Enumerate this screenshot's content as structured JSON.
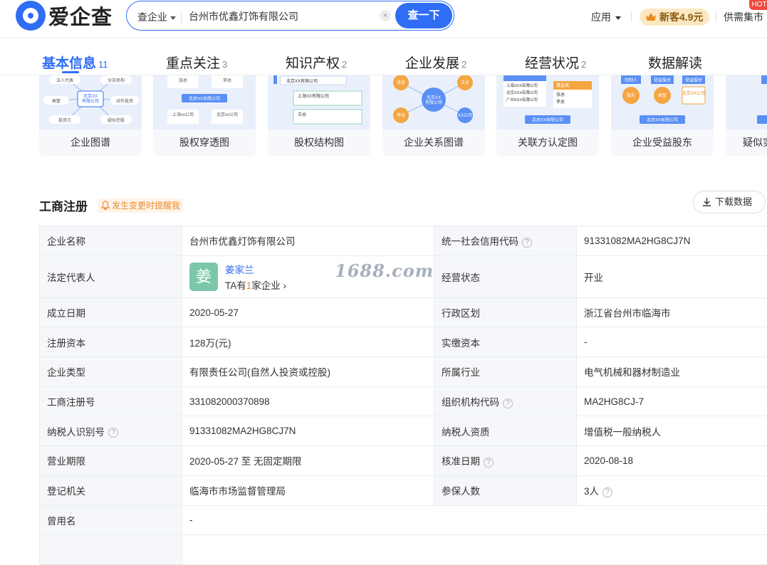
{
  "header": {
    "logo_text": "爱企查",
    "search_type": "查企业",
    "search_value": "台州市优鑫灯饰有限公司",
    "search_button": "查一下",
    "nav_apps": "应用",
    "vip_label": "新客4.9元",
    "supply_label": "供需集市",
    "hot_badge": "HOT"
  },
  "tabs": [
    {
      "label": "基本信息",
      "count": "11"
    },
    {
      "label": "重点关注",
      "count": "3"
    },
    {
      "label": "知识产权",
      "count": "2"
    },
    {
      "label": "企业发展",
      "count": "2"
    },
    {
      "label": "经营状况",
      "count": "2"
    },
    {
      "label": "数据解读",
      "count": ""
    }
  ],
  "cards": [
    {
      "label": "企业图谱",
      "icon": "graph-icon"
    },
    {
      "label": "股权穿透图",
      "icon": "equity-penetration-icon"
    },
    {
      "label": "股权结构图",
      "icon": "equity-structure-icon"
    },
    {
      "label": "企业关系图谱",
      "icon": "relation-graph-icon"
    },
    {
      "label": "关联方认定图",
      "icon": "related-party-icon"
    },
    {
      "label": "企业受益股东",
      "icon": "beneficiary-icon"
    },
    {
      "label": "疑似实",
      "icon": "suspected-controller-icon"
    }
  ],
  "card_thumbs": {
    "c1_center": "北京XX\n有限公司",
    "c1_a": "法人代表",
    "c1_b": "分支机构",
    "c1_c": "高管",
    "c1_d": "对外投资",
    "c1_e": "投资方",
    "c1_f": "疑似控股",
    "c2_a": "张总",
    "c2_b": "李总",
    "c2_center": "北京XX有限公司",
    "c2_c": "上海xx公司",
    "c2_d": "北京xx公司",
    "c3_a": "北京XX有限公司",
    "c3_b": "上海XX有限公司",
    "c3_c": "王总",
    "c4_center": "北京XX\n有限公司",
    "c4_a": "张总",
    "c4_b": "王总",
    "c4_c": "李总",
    "c4_d": "XX公司",
    "c5_a": "上海XXX有限公司",
    "c5_b": "北京XXX有限公司",
    "c5_c": "广州XXX有限公司",
    "c5_d": "董监高",
    "c5_e": "张总",
    "c5_f": "李总",
    "c5_g": "北京XX有限公司",
    "c6_a": "控制人",
    "c6_b": "受益股份",
    "c6_c": "受益股份",
    "c6_d": "股东",
    "c6_e": "高管",
    "c6_f": "北京XX公司",
    "c6_g": "北京XX有限公司"
  },
  "section": {
    "title": "工商注册",
    "alert": "发生变更时提醒我",
    "download": "下载数据",
    "watermark": "1688.com"
  },
  "registration": {
    "company_name_label": "企业名称",
    "company_name": "台州市优鑫灯饰有限公司",
    "credit_code_label": "统一社会信用代码",
    "credit_code": "91331082MA2HG8CJ7N",
    "legal_rep_label": "法定代表人",
    "legal_rep_avatar": "姜",
    "legal_rep_name": "姜家兰",
    "legal_rep_sub_pre": "TA有",
    "legal_rep_sub_num": "1",
    "legal_rep_sub_post": "家企业 ›",
    "status_label": "经营状态",
    "status": "开业",
    "est_date_label": "成立日期",
    "est_date": "2020-05-27",
    "region_label": "行政区划",
    "region": "浙江省台州市临海市",
    "reg_capital_label": "注册资本",
    "reg_capital": "128万(元)",
    "paid_capital_label": "实缴资本",
    "paid_capital": "-",
    "type_label": "企业类型",
    "type": "有限责任公司(自然人投资或控股)",
    "industry_label": "所属行业",
    "industry": "电气机械和器材制造业",
    "reg_no_label": "工商注册号",
    "reg_no": "331082000370898",
    "org_code_label": "组织机构代码",
    "org_code": "MA2HG8CJ-7",
    "tax_id_label": "纳税人识别号",
    "tax_id": "91331082MA2HG8CJ7N",
    "tax_qual_label": "纳税人资质",
    "tax_qual": "增值税一般纳税人",
    "term_label": "营业期限",
    "term": "2020-05-27 至 无固定期限",
    "approval_label": "核准日期",
    "approval": "2020-08-18",
    "authority_label": "登记机关",
    "authority": "临海市市场监督管理局",
    "insured_label": "参保人数",
    "insured": "3人",
    "former_name_label": "曾用名",
    "former_name": "-",
    "help_glyph": "?"
  },
  "colors": {
    "accent": "#2f6df5",
    "orange": "#f08a2a",
    "avatar": "#7cc7a9"
  }
}
